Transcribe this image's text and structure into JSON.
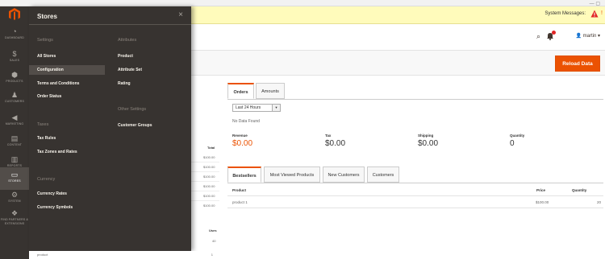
{
  "system_bar": {
    "controls": "—   ▢"
  },
  "nav": {
    "items": [
      {
        "label": "Dashboard",
        "icon": "dashboard-icon",
        "glyph": "◔"
      },
      {
        "label": "Sales",
        "icon": "dollar-icon",
        "glyph": "$"
      },
      {
        "label": "Products",
        "icon": "cube-icon",
        "glyph": "⬢"
      },
      {
        "label": "Customers",
        "icon": "person-icon",
        "glyph": "♟"
      },
      {
        "label": "Marketing",
        "icon": "megaphone-icon",
        "glyph": "◀"
      },
      {
        "label": "Content",
        "icon": "layout-icon",
        "glyph": "▤"
      },
      {
        "label": "Reports",
        "icon": "bar-chart-icon",
        "glyph": "▥"
      },
      {
        "label": "Stores",
        "icon": "store-icon",
        "glyph": "▭"
      },
      {
        "label": "System",
        "icon": "gear-icon",
        "glyph": "⚙"
      },
      {
        "label": "Find Partners & Extensions",
        "icon": "extensions-icon",
        "glyph": "❖"
      }
    ],
    "accent": "#eb5202"
  },
  "messages": {
    "text": "System Messages: "
  },
  "header": {
    "user": "martin ▾",
    "search_glyph": "⌕"
  },
  "actions": {
    "reload_label": "Reload Data"
  },
  "stores_menu": {
    "title": "Stores",
    "close": "×",
    "settings": {
      "heading": "Settings",
      "items": [
        "All Stores",
        "Configuration",
        "Terms and Conditions",
        "Order Status"
      ]
    },
    "taxes": {
      "heading": "Taxes",
      "items": [
        "Tax Rules",
        "Tax Zones and Rates"
      ]
    },
    "currency": {
      "heading": "Currency",
      "items": [
        "Currency Rates",
        "Currency Symbols"
      ]
    },
    "attributes": {
      "heading": "Attributes",
      "items": [
        "Product",
        "Attribute Set",
        "Rating"
      ]
    },
    "other": {
      "heading": "Other Settings",
      "items": [
        "Customer Groups"
      ]
    }
  },
  "dashboard": {
    "tabs": [
      "Orders",
      "Amounts"
    ],
    "period": "Last 24 Hours",
    "no_data": "No Data Found",
    "stats": [
      {
        "label": "Revenue",
        "value": "$0.00"
      },
      {
        "label": "Tax",
        "value": "$0.00"
      },
      {
        "label": "Shipping",
        "value": "$0.00"
      },
      {
        "label": "Quantity",
        "value": "0"
      }
    ],
    "tabs2": [
      "Bestsellers",
      "Most Viewed Products",
      "New Customers",
      "Customers"
    ],
    "table": {
      "headers": [
        "Product",
        "Price",
        "Quantity"
      ],
      "rows": [
        [
          "product 1",
          "$100.00",
          "20"
        ]
      ]
    }
  },
  "left_column": {
    "total_header": "Total",
    "totals": [
      "$100.00",
      "$100.00",
      "$100.00",
      "$100.00",
      "$100.00",
      "$100.00"
    ],
    "uses_header": "Uses",
    "uses": [
      "40",
      "2"
    ],
    "bottom_label": "product",
    "bottom_value": "1"
  }
}
